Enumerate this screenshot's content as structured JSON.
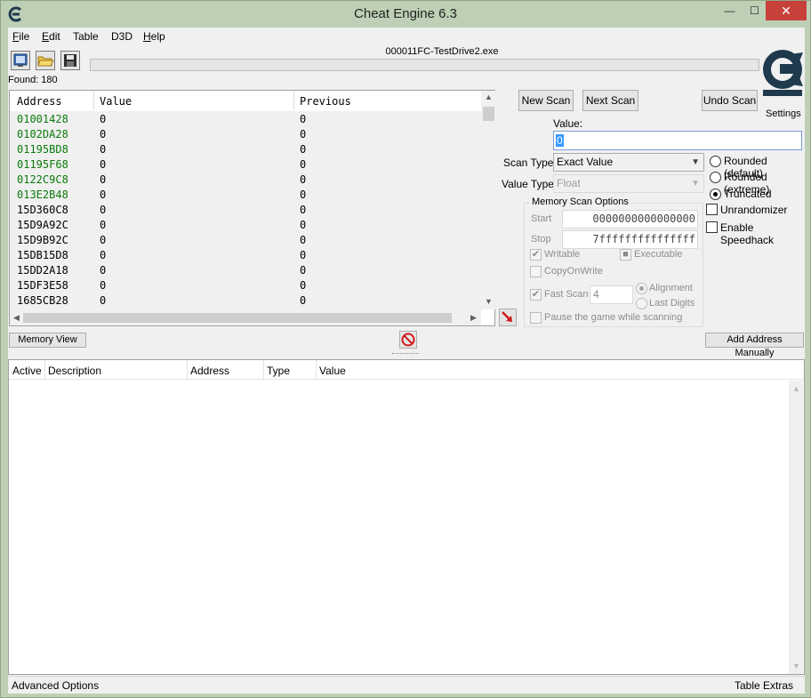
{
  "window": {
    "title": "Cheat Engine 6.3",
    "min_glyph": "—",
    "max_glyph": "☐",
    "close_glyph": "✕"
  },
  "menu": [
    {
      "label": "File",
      "underline": "F",
      "rest": "ile"
    },
    {
      "label": "Edit",
      "underline": "E",
      "rest": "dit"
    },
    {
      "label": "Table",
      "underline": "",
      "rest": "Table"
    },
    {
      "label": "D3D",
      "underline": "",
      "rest": "D3D"
    },
    {
      "label": "Help",
      "underline": "H",
      "rest": "elp"
    }
  ],
  "toolbar": {
    "icons": [
      "select-process-icon",
      "open-file-icon",
      "save-icon"
    ]
  },
  "process": {
    "name": "000011FC-TestDrive2.exe",
    "progress_percent": 0
  },
  "found": {
    "label": "Found: 180"
  },
  "settings_label": "Settings",
  "results": {
    "headers": [
      "Address",
      "Value",
      "Previous"
    ],
    "rows": [
      {
        "address": "01001428",
        "value": "0",
        "previous": "0",
        "green": true
      },
      {
        "address": "0102DA28",
        "value": "0",
        "previous": "0",
        "green": true
      },
      {
        "address": "01195BD8",
        "value": "0",
        "previous": "0",
        "green": true
      },
      {
        "address": "01195F68",
        "value": "0",
        "previous": "0",
        "green": true
      },
      {
        "address": "0122C9C8",
        "value": "0",
        "previous": "0",
        "green": true
      },
      {
        "address": "013E2B48",
        "value": "0",
        "previous": "0",
        "green": true
      },
      {
        "address": "15D360C8",
        "value": "0",
        "previous": "0",
        "green": false
      },
      {
        "address": "15D9A92C",
        "value": "0",
        "previous": "0",
        "green": false
      },
      {
        "address": "15D9B92C",
        "value": "0",
        "previous": "0",
        "green": false
      },
      {
        "address": "15DB15D8",
        "value": "0",
        "previous": "0",
        "green": false
      },
      {
        "address": "15DD2A18",
        "value": "0",
        "previous": "0",
        "green": false
      },
      {
        "address": "15DF3E58",
        "value": "0",
        "previous": "0",
        "green": false
      },
      {
        "address": "1685CB28",
        "value": "0",
        "previous": "0",
        "green": false
      }
    ]
  },
  "scan": {
    "new_scan": "New Scan",
    "next_scan": "Next Scan",
    "undo_scan": "Undo Scan",
    "value_label": "Value:",
    "value": "0",
    "scan_type_label": "Scan Type",
    "scan_type": "Exact Value",
    "value_type_label": "Value Type",
    "value_type": "Float",
    "rounding": [
      {
        "label": "Rounded (default)",
        "selected": false
      },
      {
        "label": "Rounded (extreme)",
        "selected": false
      },
      {
        "label": "Truncated",
        "selected": true
      }
    ],
    "unrandomizer": "Unrandomizer",
    "speedhack": "Enable Speedhack"
  },
  "memory_options": {
    "title": "Memory Scan Options",
    "start_label": "Start",
    "start": "0000000000000000",
    "stop_label": "Stop",
    "stop": "7fffffffffffffff",
    "writable": "Writable",
    "executable": "Executable",
    "copyonwrite": "CopyOnWrite",
    "fast_scan": "Fast Scan",
    "fast_scan_value": "4",
    "alignment": "Alignment",
    "last_digits": "Last Digits",
    "pause": "Pause the game while scanning"
  },
  "bottom_bar": {
    "memory_view": "Memory View",
    "add_address": "Add Address Manually"
  },
  "address_list": {
    "headers": [
      "Active",
      "Description",
      "Address",
      "Type",
      "Value"
    ]
  },
  "status": {
    "advanced": "Advanced Options",
    "extras": "Table Extras"
  },
  "colors": {
    "frame": "#bdd0b5",
    "close": "#c7413a",
    "green_address": "#0b7a0b",
    "logo": "#1f3a4d"
  }
}
